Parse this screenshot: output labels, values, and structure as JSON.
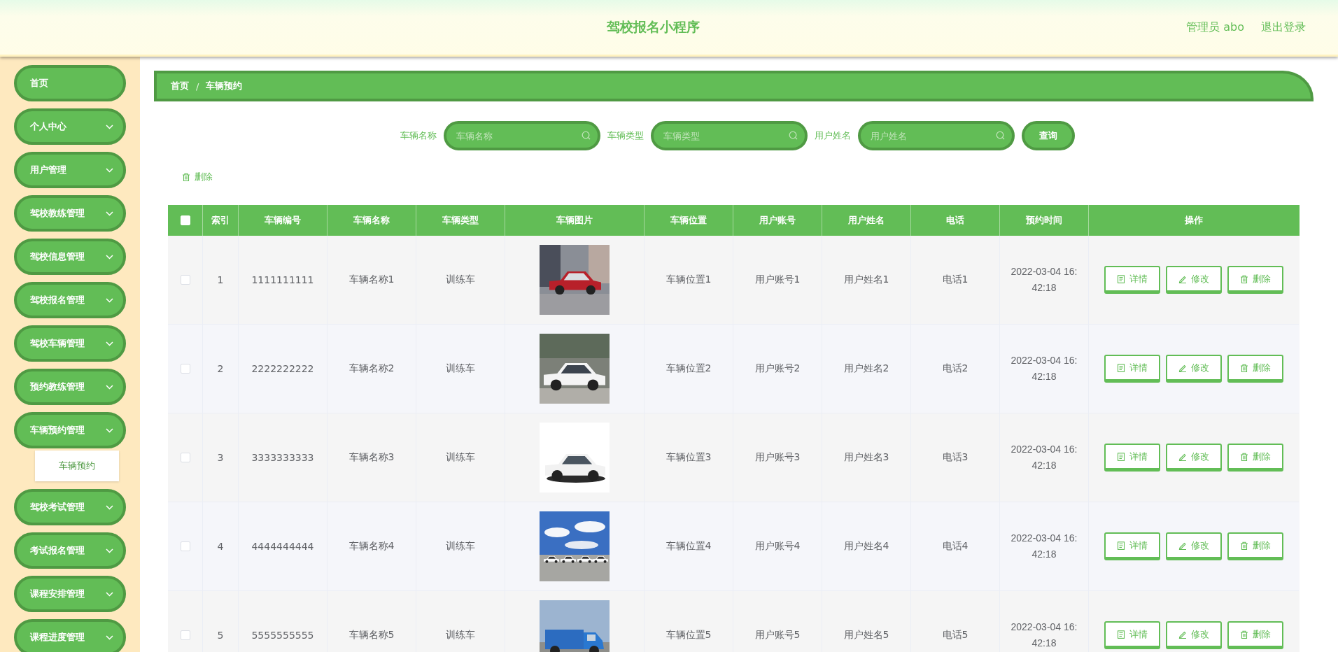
{
  "header": {
    "title": "驾校报名小程序",
    "user": "管理员 abo",
    "logout": "退出登录"
  },
  "sidebar": {
    "items": [
      {
        "label": "首页",
        "kind": "link"
      },
      {
        "label": "个人中心",
        "kind": "menu"
      },
      {
        "label": "用户管理",
        "kind": "menu"
      },
      {
        "label": "驾校教练管理",
        "kind": "menu"
      },
      {
        "label": "驾校信息管理",
        "kind": "menu"
      },
      {
        "label": "驾校报名管理",
        "kind": "menu"
      },
      {
        "label": "驾校车辆管理",
        "kind": "menu"
      },
      {
        "label": "预约教练管理",
        "kind": "menu"
      },
      {
        "label": "车辆预约管理",
        "kind": "menu",
        "children": [
          {
            "label": "车辆预约",
            "selected": true
          }
        ]
      },
      {
        "label": "驾校考试管理",
        "kind": "menu"
      },
      {
        "label": "考试报名管理",
        "kind": "menu"
      },
      {
        "label": "课程安排管理",
        "kind": "menu"
      },
      {
        "label": "课程进度管理",
        "kind": "menu"
      }
    ]
  },
  "breadcrumb": {
    "items": [
      "首页",
      "车辆预约"
    ],
    "separator": "/"
  },
  "search": {
    "fields": [
      {
        "label": "车辆名称",
        "placeholder": "车辆名称"
      },
      {
        "label": "车辆类型",
        "placeholder": "车辆类型"
      },
      {
        "label": "用户姓名",
        "placeholder": "用户姓名"
      }
    ],
    "button": "查询"
  },
  "toolbar": {
    "delete": "删除"
  },
  "table": {
    "all_checked": false,
    "columns": [
      "索引",
      "车辆编号",
      "车辆名称",
      "车辆类型",
      "车辆图片",
      "车辆位置",
      "用户账号",
      "用户姓名",
      "电话",
      "预约时间",
      "操作"
    ],
    "rows": [
      {
        "checked": false,
        "index": "1",
        "number": "1111111111",
        "name": "车辆名称1",
        "type": "训练车",
        "location": "车辆位置1",
        "account": "用户账号1",
        "user_name": "用户姓名1",
        "phone": "电话1",
        "time": "2022-03-04 16:42:18",
        "actions": [
          "详情",
          "修改",
          "删除"
        ]
      },
      {
        "checked": false,
        "index": "2",
        "number": "2222222222",
        "name": "车辆名称2",
        "type": "训练车",
        "location": "车辆位置2",
        "account": "用户账号2",
        "user_name": "用户姓名2",
        "phone": "电话2",
        "time": "2022-03-04 16:42:18",
        "actions": [
          "详情",
          "修改",
          "删除"
        ]
      },
      {
        "checked": false,
        "index": "3",
        "number": "3333333333",
        "name": "车辆名称3",
        "type": "训练车",
        "location": "车辆位置3",
        "account": "用户账号3",
        "user_name": "用户姓名3",
        "phone": "电话3",
        "time": "2022-03-04 16:42:18",
        "actions": [
          "详情",
          "修改",
          "删除"
        ]
      },
      {
        "checked": false,
        "index": "4",
        "number": "4444444444",
        "name": "车辆名称4",
        "type": "训练车",
        "location": "车辆位置4",
        "account": "用户账号4",
        "user_name": "用户姓名4",
        "phone": "电话4",
        "time": "2022-03-04 16:42:18",
        "actions": [
          "详情",
          "修改",
          "删除"
        ]
      },
      {
        "checked": false,
        "index": "5",
        "number": "5555555555",
        "name": "车辆名称5",
        "type": "训练车",
        "location": "车辆位置5",
        "account": "用户账号5",
        "user_name": "用户姓名5",
        "phone": "电话5",
        "time": "2022-03-04 16:42:18",
        "actions": [
          "详情",
          "修改",
          "删除"
        ]
      }
    ]
  }
}
